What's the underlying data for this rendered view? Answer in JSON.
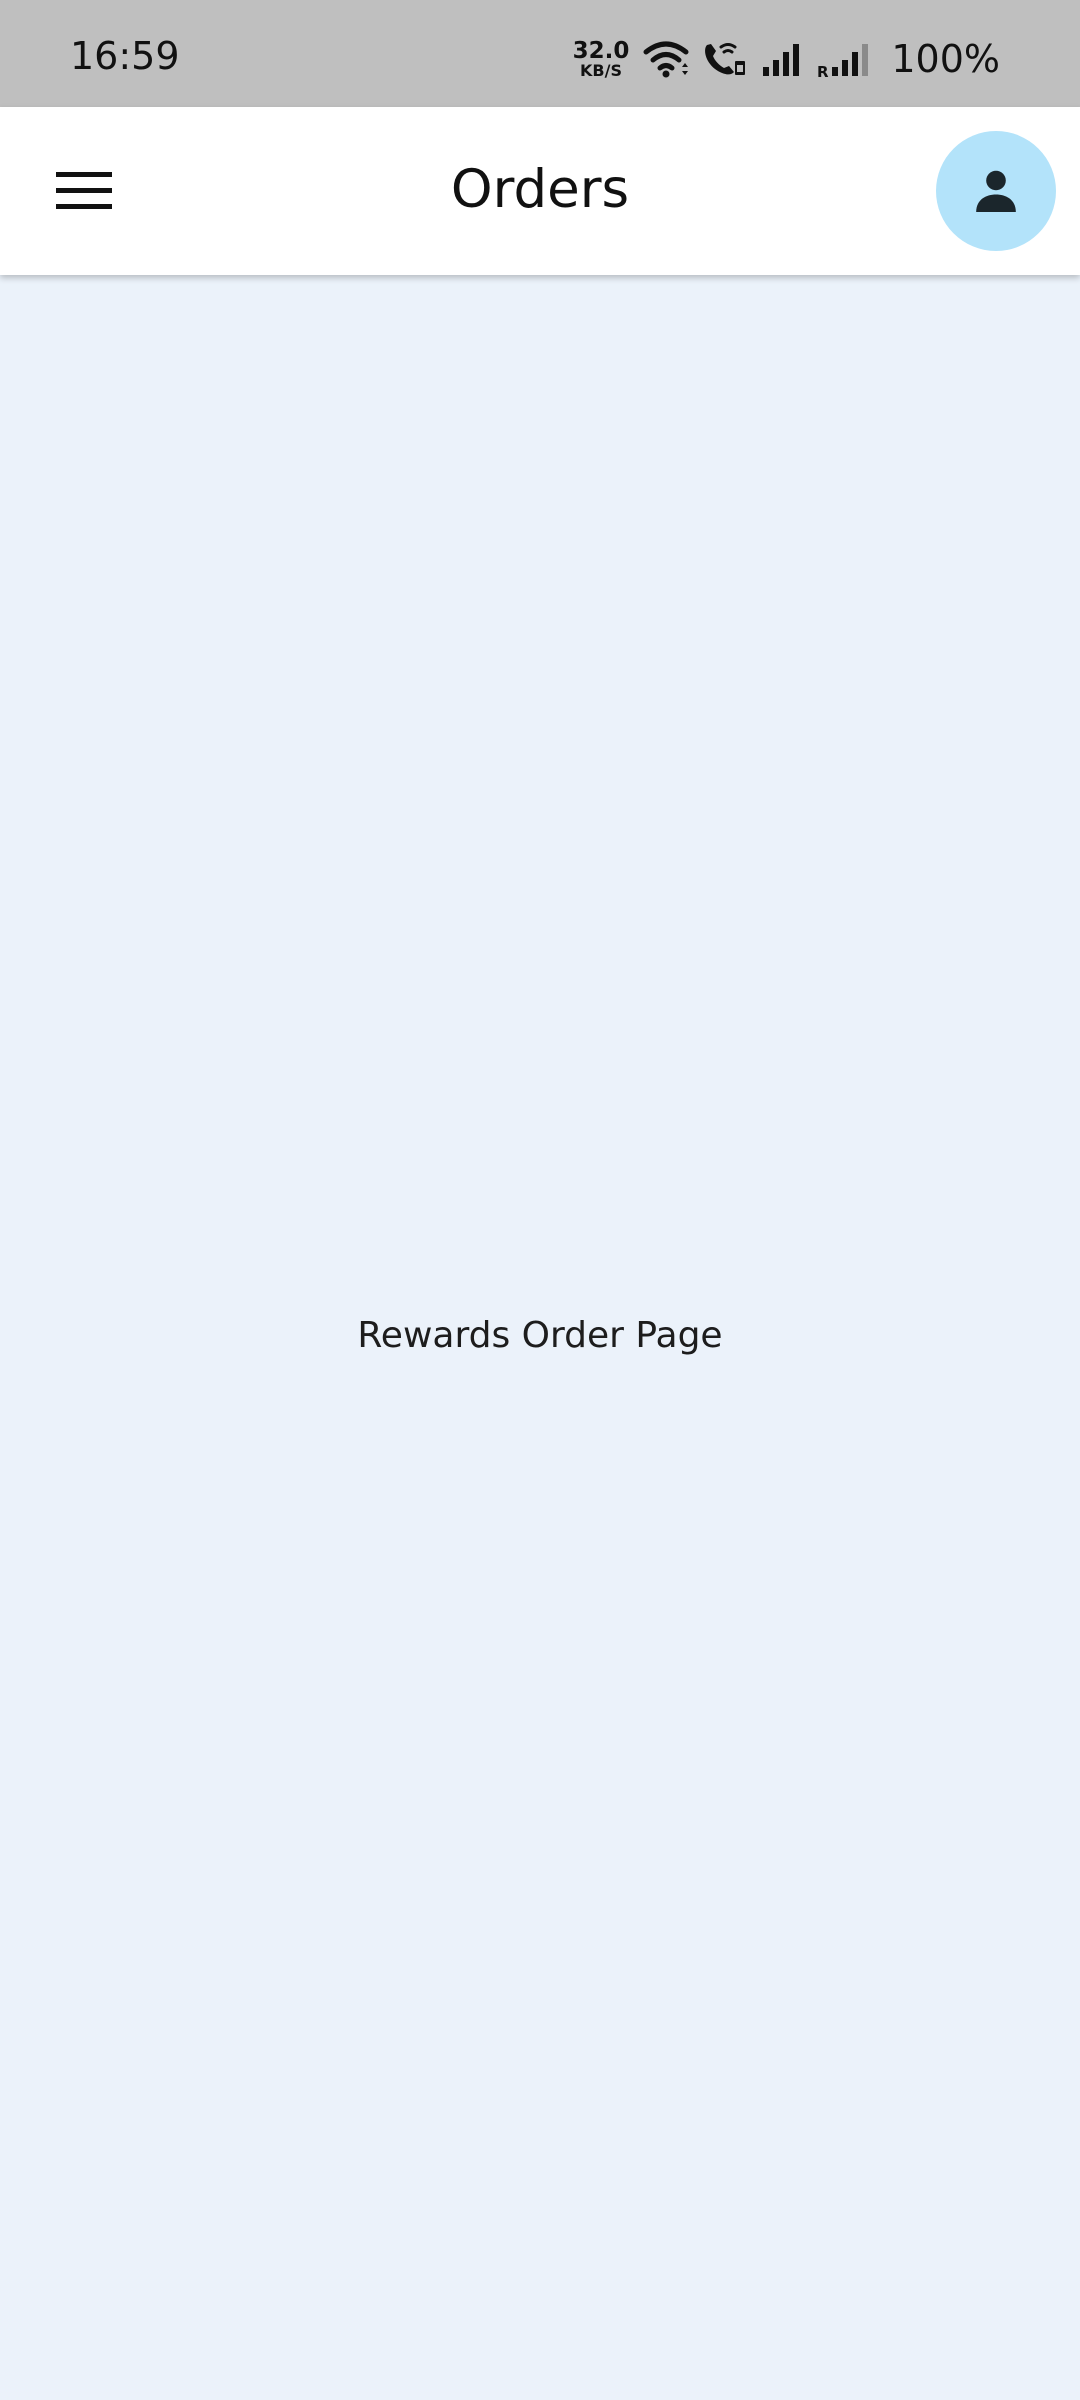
{
  "status_bar": {
    "time": "16:59",
    "net_speed_value": "32.0",
    "net_speed_unit": "KB/S",
    "battery": "100%",
    "icons": [
      "wifi-icon",
      "wifi-calling-icon",
      "signal-sim1-icon",
      "signal-roaming-sim2-icon"
    ]
  },
  "app_bar": {
    "title": "Orders",
    "menu_icon": "hamburger-menu-icon",
    "avatar_icon": "person-icon",
    "avatar_color": "#b3e3fa"
  },
  "content": {
    "message": "Rewards Order Page",
    "background_color": "#ebf2fa"
  }
}
